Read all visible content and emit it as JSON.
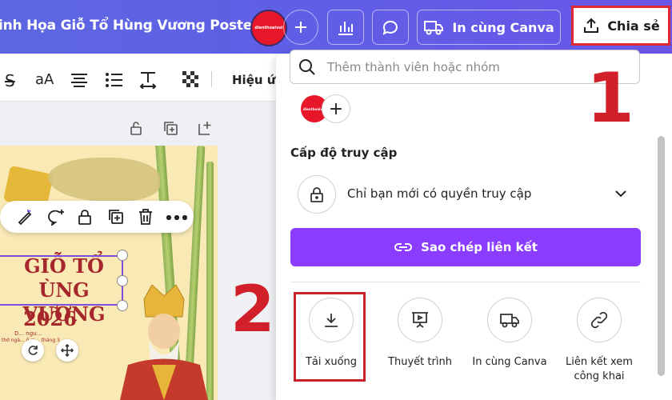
{
  "header": {
    "doc_title": "inh Họa Giỗ Tổ Hùng Vương Poster",
    "brand_avatar_text": "dienthoaivui",
    "print_button": "In cùng Canva",
    "share_button": "Chia sẻ"
  },
  "toolbar": {
    "font_size_label": "aA",
    "effects_label": "Hiệu ứ"
  },
  "poster": {
    "title_line1": "GIỖ TỔ",
    "title_line2": "ÙNG VƯƠNG",
    "year": "2026",
    "small_line1": "D... ngu...",
    "small_line2": "thờ ngà... ố m... tháng 3"
  },
  "share_panel": {
    "search_placeholder": "Thêm thành viên hoặc nhóm",
    "member_avatar_text": "dienthoaivui",
    "access_heading": "Cấp độ truy cập",
    "access_value": "Chỉ bạn mới có quyền truy cập",
    "copy_link_button": "Sao chép liên kết",
    "options": [
      {
        "label": "Tải xuống",
        "icon": "download-icon"
      },
      {
        "label": "Thuyết trình",
        "icon": "presentation-icon"
      },
      {
        "label": "In cùng Canva",
        "icon": "truck-icon"
      },
      {
        "label": "Liên kết xem công khai",
        "icon": "link-icon"
      }
    ]
  },
  "annotations": {
    "step1": "1",
    "step2": "2"
  },
  "colors": {
    "topbar": "#5f5ee6",
    "accent_purple": "#8b3dff",
    "highlight_red": "#e1262d"
  }
}
